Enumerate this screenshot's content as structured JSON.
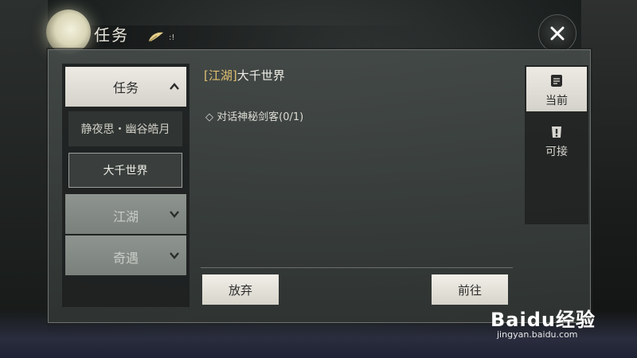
{
  "header": {
    "title": "任务",
    "subtitle": ":!",
    "close_icon": "close-icon"
  },
  "tree": {
    "main": {
      "label": "任务",
      "expanded": true
    },
    "subitems": [
      {
        "label": "静夜思・幽谷皓月",
        "selected": false
      },
      {
        "label": "大千世界",
        "selected": true
      }
    ],
    "categories": [
      {
        "label": "江湖",
        "expanded": false
      },
      {
        "label": "奇遇",
        "expanded": false
      }
    ]
  },
  "content": {
    "quest_tag": "[江湖]",
    "quest_name": "大千世界",
    "objective": "◇ 对话神秘剑客(0/1)",
    "abandon_label": "放弃",
    "goto_label": "前往"
  },
  "tabs": [
    {
      "label": "当前",
      "icon": "scroll-icon",
      "active": true
    },
    {
      "label": "可接",
      "icon": "scroll-exclamation-icon",
      "active": false
    }
  ],
  "watermark": {
    "logo": "Baidu经验",
    "url": "jingyan.baidu.com"
  },
  "colors": {
    "quest_tag": "#e0c070",
    "button_bg": "#ece9e1",
    "frame": "#4a504e"
  }
}
